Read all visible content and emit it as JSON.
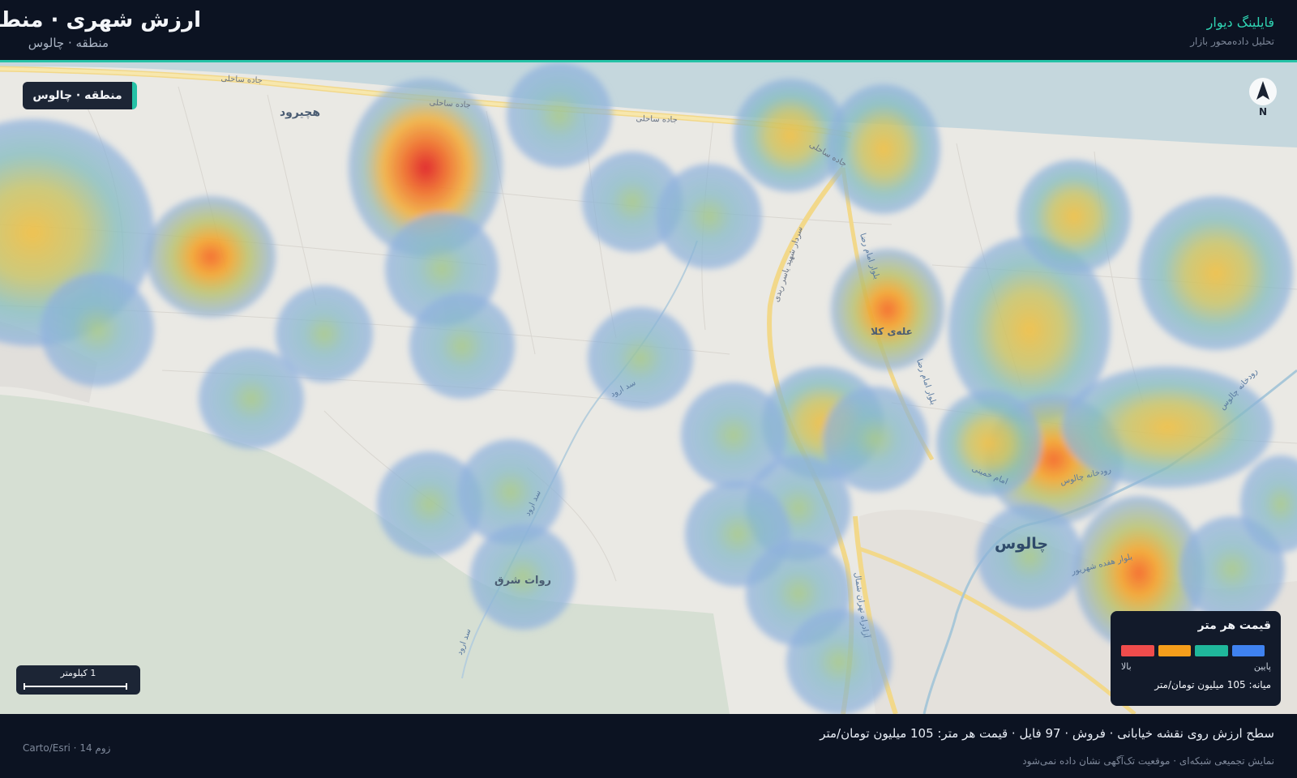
{
  "header": {
    "title": "ارزش شهری · منطقه",
    "subtitle": "منطقه · چالوس",
    "brand": "فایلینگ دیوار",
    "tagline": "تحلیل داده‌محور بازار"
  },
  "map": {
    "region_chip": "منطقه · چالوس",
    "compass_label": "N",
    "scale_label": "1 کیلومتر",
    "labels": {
      "city_chalus": "چالوس",
      "town_hachirud": "هچیرود",
      "village_alei_kola": "علەی کلا",
      "village_ravat_sharq": "روات شرق",
      "road_coastal_1": "جاده ساحلی",
      "road_coastal_2": "جاده ساحلی",
      "road_coastal_3": "جاده ساحلی",
      "road_coastal_4": "جاده ساحلی",
      "road_sardar": "سردار شهید یاسر ربدی",
      "road_imam_reza": "بلوار امام رضا",
      "road_imam_reza_2": "بلوار امام رضا",
      "road_karaj": "آزادراه تهران شمال",
      "river_chalus": "رودخانه چالوس",
      "river_chalus_2": "رودخانه چالوس",
      "road_17_shahrivar": "بلوار هفده شهریور",
      "road_imam_khomeini": "امام خمینی",
      "dam_road": "سد ارود",
      "dam_road_2": "سد ارود",
      "dam_road_3": "سد ارود"
    },
    "heat_colors": {
      "low": "#8fb0e0",
      "mid": "#2fb89d",
      "high_mid": "#f0a527",
      "high": "#e23a3a"
    }
  },
  "legend": {
    "title": "قیمت هر متر",
    "high_label": "بالا",
    "low_label": "پایین",
    "median": "میانه: 105 میلیون تومان/متر",
    "swatches": [
      "#ef4c4c",
      "#f59e1b",
      "#1fb79b",
      "#3f82f0"
    ]
  },
  "footer": {
    "main": "سطح ارزش روی نقشه خیابانی · فروش · 97 فایل · قیمت هر متر: 105 میلیون تومان/متر",
    "note": "نمایش تجمیعی شبکه‌ای · موقعیت تک‌آگهی نشان داده نمی‌شود",
    "zoom": "زوم 14 · Carto/Esri"
  }
}
